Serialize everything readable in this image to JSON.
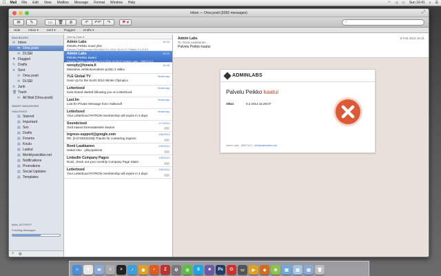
{
  "menubar": {
    "app": "Mail",
    "items": [
      "File",
      "Edit",
      "View",
      "Mailbox",
      "Message",
      "Format",
      "Window",
      "Help"
    ],
    "status_right": "Sun 16:41"
  },
  "window": {
    "title": "Inbox — Oma posti (9392 messages)"
  },
  "favorites": {
    "hide": "Hide",
    "inbox": "Inbox",
    "sent": "Sent",
    "flagged": "Flagged",
    "drafts": "Drafts"
  },
  "sidebar": {
    "mailboxes_head": "MAILBOXES",
    "items": [
      {
        "label": "Inbox",
        "icon": "✉",
        "sub": false,
        "sel": false
      },
      {
        "label": "Oma posti",
        "icon": "✉",
        "sub": true,
        "sel": true
      },
      {
        "label": "DLSEI",
        "icon": "✉",
        "sub": true,
        "sel": false
      },
      {
        "label": "Flagged",
        "icon": "⚑",
        "sub": false,
        "sel": false
      },
      {
        "label": "Drafts",
        "icon": "✎",
        "sub": false,
        "sel": false
      },
      {
        "label": "Sent",
        "icon": "➤",
        "sub": false,
        "sel": false
      },
      {
        "label": "Oma posti",
        "icon": "✉",
        "sub": true,
        "sel": false
      },
      {
        "label": "DLSEI",
        "icon": "✉",
        "sub": true,
        "sel": false
      },
      {
        "label": "Junk",
        "icon": "⊘",
        "sub": false,
        "sel": false
      },
      {
        "label": "Trash",
        "icon": "🗑",
        "sub": false,
        "sel": false
      },
      {
        "label": "All Mail (Oma posti)",
        "icon": "✉",
        "sub": true,
        "sel": false
      }
    ],
    "smart_head": "SMART MAILBOXES",
    "oma_head": "OMA POSTI",
    "folders": [
      "Starred",
      "Important",
      "Sex",
      "Drafts",
      "Forums",
      "Koulu",
      "Laskut",
      "Merkityssivikko.net",
      "Notifications",
      "Promotions",
      "Social Updates",
      "Templates"
    ],
    "footer_label": "MAIL ACTIVITY",
    "footer_status": "Fetching Messages"
  },
  "list": {
    "sort": "Sort by Date ▾",
    "messages": [
      {
        "from": "Admin Labs",
        "date": "16:33",
        "subj": "Palvelu Peikko nousi ylös",
        "prev": "Palvelu Peikko nousi ylös Alkoi 9.2.2014 16.29.07 Päättyi 9.2.2014",
        "sel": false
      },
      {
        "from": "Admin Labs",
        "date": "16:24",
        "subj": "Palvelu Peikko kaatui",
        "prev": "Palvelu Peikko kaatui Alkoi 9.2.2014 16.29.07 Admin Labs · 2560714-2",
        "sel": true
      },
      {
        "from": "noreply@fonera.fi",
        "date": "15:48",
        "subj": "Muistutus verkkotunnuksen poisto 3 viikko",
        "prev": "",
        "sel": false
      },
      {
        "from": "YLE Global TV",
        "date": "Yesterday",
        "subj": "Gear Up for the Sochi 2014 Winter Olympics",
        "prev": "",
        "sel": false
      },
      {
        "from": "Letterboxd",
        "date": "Yesterday",
        "subj": "Kula Seeed started following you on Letterboxd",
        "prev": "",
        "sel": false
      },
      {
        "from": "Last.fm",
        "date": "Yesterday",
        "subj": "Lost.fm Private Message from: Naksnoft",
        "prev": "",
        "sel": false
      },
      {
        "from": "Letterboxd",
        "date": "Yesterday",
        "subj": "Your Letterboxd PATRON membership will expire in 3 days",
        "prev": "",
        "sel": false
      },
      {
        "from": "Soundcloud",
        "date": "2/7/2014",
        "subj": "Oisit saanut facenatateiden kautun",
        "prev": "",
        "sel": false
      },
      {
        "from": "ingress-support@google.com",
        "date": "2/6/2014",
        "subj": "RE: [3-5749333338] Thanks for contacting Ingress",
        "prev": "",
        "sel": false
      },
      {
        "from": "Ronii Laukkanen",
        "date": "2/5/2014",
        "subj": "Hatuit Alex - ykkyopalvelu",
        "prev": "",
        "sel": false
      },
      {
        "from": "LinkedIn Company Pages",
        "date": "2/5/2014",
        "subj": "Ronii, check out your monthly Company Page Stats!",
        "prev": "",
        "sel": false
      },
      {
        "from": "Letterboxd",
        "date": "2/5/2014",
        "subj": "Your Letterboxd PATRON membership will expire in 4 days",
        "prev": "",
        "sel": false
      }
    ]
  },
  "reader": {
    "from": "Admin Labs",
    "to": "To: Ronii Laukkanen",
    "subject": "Palvelu Peikko kaatui",
    "date": "9 Feb 2014 16:31",
    "brand": "ADMINLABS",
    "title_service": "Palvelu Peikko",
    "title_status": "kaatui",
    "row_key": "Alkoi",
    "row_value": "9.2.2014 16.29.07",
    "footer_text": "Admin Labs · 2560714-2 · ",
    "footer_link": "info@adminlabs.com"
  },
  "colors": {
    "accent": "#3a6fc6",
    "error": "#dd5a38",
    "status_text": "#d9421b"
  },
  "dock": {
    "icons": [
      {
        "name": "finder-icon",
        "glyph": "☺",
        "bg": "#4a90d9"
      },
      {
        "name": "calendar-icon",
        "glyph": "9",
        "bg": "#e8e8e8"
      },
      {
        "name": "mail-icon",
        "glyph": "✉",
        "bg": "#8aa9d6"
      },
      {
        "name": "notes-icon",
        "glyph": "≡",
        "bg": "#aaaaaa"
      },
      {
        "name": "terminal-icon",
        "glyph": ">",
        "bg": "#222222"
      },
      {
        "name": "music-icon",
        "glyph": "♪",
        "bg": "#3ba0e0"
      },
      {
        "name": "chrome-icon",
        "glyph": "◉",
        "bg": "#e0a020"
      },
      {
        "name": "firefox-icon",
        "glyph": "◐",
        "bg": "#e25a1c"
      },
      {
        "name": "filezilla-icon",
        "glyph": "Z",
        "bg": "#c0302a"
      },
      {
        "name": "gear-icon",
        "glyph": "⚙",
        "bg": "#7a7a7a"
      },
      {
        "name": "spotify-icon",
        "glyph": "◎",
        "bg": "#5cbd45"
      },
      {
        "name": "skype-icon",
        "glyph": "S",
        "bg": "#19a6e8"
      },
      {
        "name": "app-icon",
        "glyph": "■",
        "bg": "#6b5aa8"
      },
      {
        "name": "photoshop-icon",
        "glyph": "Ps",
        "bg": "#1f3b66"
      },
      {
        "name": "power-icon",
        "glyph": "⏻",
        "bg": "#d12e2e"
      },
      {
        "name": "display-icon",
        "glyph": "▭",
        "bg": "#555555"
      },
      {
        "name": "play-icon",
        "glyph": "▶",
        "bg": "#e0a020"
      },
      {
        "name": "app2-icon",
        "glyph": "◆",
        "bg": "#d46a1a"
      },
      {
        "name": "app3-icon",
        "glyph": "✿",
        "bg": "#8bc34a"
      },
      {
        "name": "folder-icon",
        "glyph": "▤",
        "bg": "#6fa8dc"
      },
      {
        "name": "folder2-icon",
        "glyph": "▤",
        "bg": "#9fc5e8"
      },
      {
        "name": "folder3-icon",
        "glyph": "▤",
        "bg": "#8aa9d6"
      },
      {
        "name": "trash-icon",
        "glyph": "🗑",
        "bg": "#bdbdbd"
      }
    ]
  }
}
